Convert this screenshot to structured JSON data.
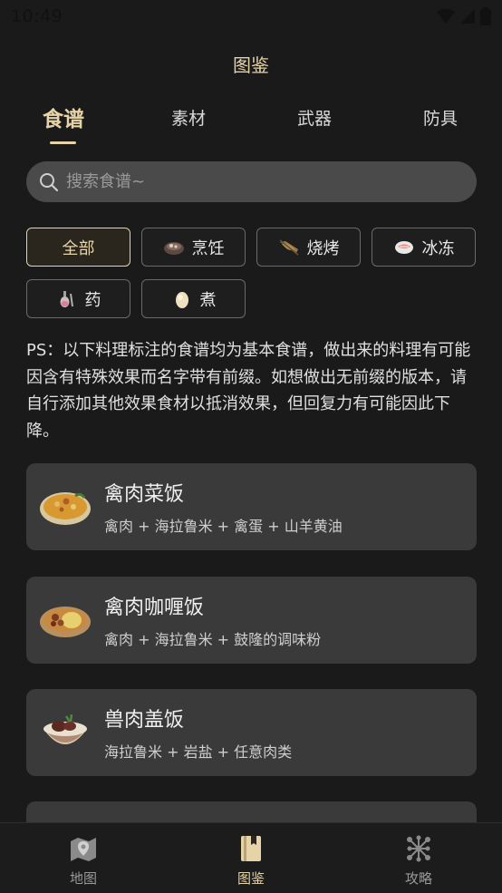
{
  "status_bar": {
    "time": "10:49"
  },
  "header": {
    "title": "图鉴"
  },
  "tabs": [
    {
      "label": "食谱",
      "active": true
    },
    {
      "label": "素材",
      "active": false
    },
    {
      "label": "武器",
      "active": false
    },
    {
      "label": "防具",
      "active": false
    }
  ],
  "search": {
    "placeholder": "搜索食谱~",
    "value": ""
  },
  "filters": [
    {
      "label": "全部",
      "active": true,
      "icon": "none"
    },
    {
      "label": "烹饪",
      "active": false,
      "icon": "cooking-pot-icon"
    },
    {
      "label": "烧烤",
      "active": false,
      "icon": "roast-fish-icon"
    },
    {
      "label": "冰冻",
      "active": false,
      "icon": "frozen-food-icon"
    },
    {
      "label": "药",
      "active": false,
      "icon": "elixir-bottle-icon"
    },
    {
      "label": "煮",
      "active": false,
      "icon": "boiled-egg-icon"
    }
  ],
  "note": "PS：以下料理标注的食谱均为基本食谱，做出来的料理有可能因含有特殊效果而名字带有前缀。如想做出无前缀的版本，请自行添加其他效果食材以抵消效果，但回复力有可能因此下降。",
  "recipes": [
    {
      "name": "禽肉菜饭",
      "ingredients": "禽肉 + 海拉鲁米 + 禽蛋 + 山羊黄油",
      "icon": "poultry-pilaf-icon"
    },
    {
      "name": "禽肉咖喱饭",
      "ingredients": "禽肉 + 海拉鲁米 + 鼓隆的调味粉",
      "icon": "poultry-curry-icon"
    },
    {
      "name": "兽肉盖饭",
      "ingredients": "海拉鲁米 + 岩盐 + 任意肉类",
      "icon": "meat-rice-bowl-icon"
    }
  ],
  "bottom_nav": [
    {
      "label": "地图",
      "active": false,
      "icon": "map-icon"
    },
    {
      "label": "图鉴",
      "active": true,
      "icon": "book-icon"
    },
    {
      "label": "攻略",
      "active": false,
      "icon": "network-icon"
    }
  ],
  "colors": {
    "background": "#1a1a1a",
    "accent": "#e6d3a8",
    "card": "#3a3a3a",
    "search": "#4a4a4a"
  }
}
